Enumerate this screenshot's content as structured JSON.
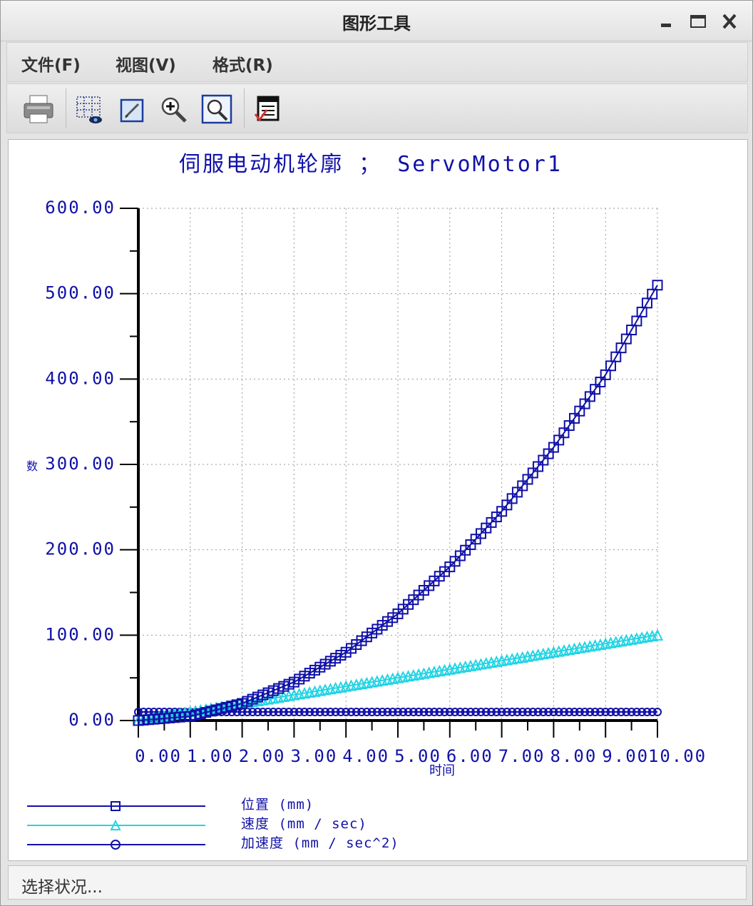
{
  "window": {
    "title": "图形工具"
  },
  "menu": {
    "items": [
      "文件(F)",
      "视图(V)",
      "格式(R)"
    ]
  },
  "toolbar": {
    "icons": [
      "print-icon",
      "grid-view-icon",
      "edit-icon",
      "zoom-in-icon",
      "zoom-fit-icon",
      "export-icon"
    ]
  },
  "status": {
    "text": "选择状况..."
  },
  "colors": {
    "accent": "#1010a8",
    "cyan": "#22d4e4",
    "axis": "#000000",
    "grid": "#9a9a9a"
  },
  "chart_data": {
    "type": "line",
    "title": "伺服电动机轮廓 ； ServoMotor1",
    "xlabel": "时间",
    "ylabel": "数",
    "xlim": [
      0,
      10
    ],
    "ylim": [
      0,
      600
    ],
    "x_ticks": [
      "0.00",
      "1.00",
      "2.00",
      "3.00",
      "4.00",
      "5.00",
      "6.00",
      "7.00",
      "8.00",
      "9.00",
      "10.00"
    ],
    "y_ticks": [
      "0.00",
      "100.00",
      "200.00",
      "300.00",
      "400.00",
      "500.00",
      "600.00"
    ],
    "grid": true,
    "legend_position": "bottom",
    "series": [
      {
        "name": "位置 (mm)",
        "marker": "square",
        "color": "#1010a8",
        "x": [
          0,
          1,
          2,
          3,
          4,
          5,
          6,
          7,
          8,
          9,
          10
        ],
        "y": [
          0,
          5,
          20,
          45,
          80,
          125,
          180,
          245,
          320,
          405,
          510
        ]
      },
      {
        "name": "速度 (mm / sec)",
        "marker": "triangle",
        "color": "#22d4e4",
        "x": [
          0,
          1,
          2,
          3,
          4,
          5,
          6,
          7,
          8,
          9,
          10
        ],
        "y": [
          0,
          10,
          20,
          30,
          40,
          50,
          60,
          70,
          80,
          90,
          100
        ]
      },
      {
        "name": "加速度 (mm / sec^2)",
        "marker": "circle",
        "color": "#1010a8",
        "x": [
          0,
          1,
          2,
          3,
          4,
          5,
          6,
          7,
          8,
          9,
          10
        ],
        "y": [
          10,
          10,
          10,
          10,
          10,
          10,
          10,
          10,
          10,
          10,
          10
        ]
      }
    ]
  }
}
